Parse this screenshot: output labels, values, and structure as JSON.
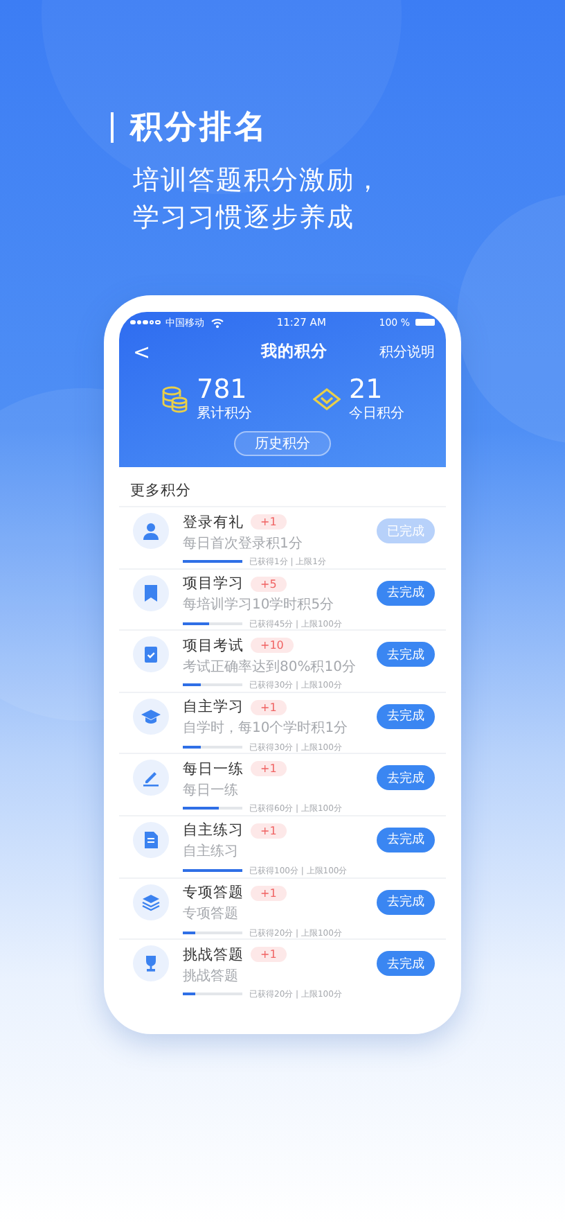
{
  "headline": {
    "title": "积分排名",
    "subtitle_lines": [
      "培训答题积分激励，",
      "学习习惯逐步养成"
    ]
  },
  "status_bar": {
    "carrier": "中国移动",
    "time": "11:27 AM",
    "battery": "100 %"
  },
  "nav": {
    "back": "<",
    "title": "我的积分",
    "action": "积分说明"
  },
  "summary": [
    {
      "value": "781",
      "label": "累计积分"
    },
    {
      "value": "21",
      "label": "今日积分"
    }
  ],
  "history_button": "历史积分",
  "section_title": "更多积分",
  "tasks": [
    {
      "title": "登录有礼",
      "points": "+1",
      "desc": "每日首次登录积1分",
      "level": 1.0,
      "progress": "已获得1分 | 上限1分",
      "button": "已完成",
      "done": true
    },
    {
      "title": "项目学习",
      "points": "+5",
      "desc": "每培训学习10学时积5分",
      "level": 0.45,
      "progress": "已获得45分 | 上限100分",
      "button": "去完成",
      "done": false
    },
    {
      "title": "项目考试",
      "points": "+10",
      "desc": "考试正确率达到80%积10分",
      "level": 0.3,
      "progress": "已获得30分 | 上限100分",
      "button": "去完成",
      "done": false
    },
    {
      "title": "自主学习",
      "points": "+1",
      "desc": "自学时，每10个学时积1分",
      "level": 0.3,
      "progress": "已获得30分 | 上限100分",
      "button": "去完成",
      "done": false
    },
    {
      "title": "每日一练",
      "points": "+1",
      "desc": "每日一练",
      "level": 0.6,
      "progress": "已获得60分 | 上限100分",
      "button": "去完成",
      "done": false
    },
    {
      "title": "自主练习",
      "points": "+1",
      "desc": "自主练习",
      "level": 1.0,
      "progress": "已获得100分 | 上限100分",
      "button": "去完成",
      "done": false
    },
    {
      "title": "专项答题",
      "points": "+1",
      "desc": "专项答题",
      "level": 0.2,
      "progress": "已获得20分 | 上限100分",
      "button": "去完成",
      "done": false
    },
    {
      "title": "挑战答题",
      "points": "+1",
      "desc": "挑战答题",
      "level": 0.2,
      "progress": "已获得20分 | 上限100分",
      "button": "去完成",
      "done": false
    }
  ]
}
